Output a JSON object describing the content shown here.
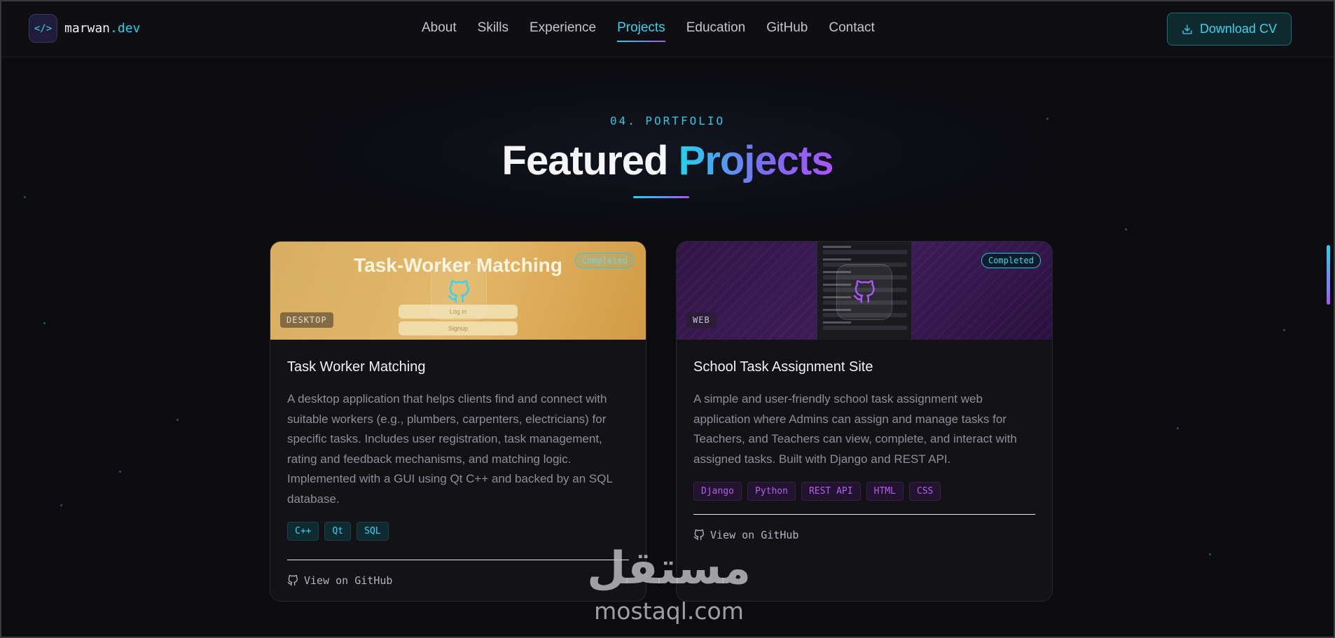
{
  "nav": {
    "brand_name": "marwan",
    "brand_tld": ".dev",
    "brand_icon": "</>",
    "links": [
      {
        "label": "About",
        "active": false
      },
      {
        "label": "Skills",
        "active": false
      },
      {
        "label": "Experience",
        "active": false
      },
      {
        "label": "Projects",
        "active": true
      },
      {
        "label": "Education",
        "active": false
      },
      {
        "label": "GitHub",
        "active": false
      },
      {
        "label": "Contact",
        "active": false
      }
    ],
    "cta_label": "Download CV",
    "cta_icon": "download-icon"
  },
  "section": {
    "eyebrow": "04. PORTFOLIO",
    "title_plain": "Featured ",
    "title_accent": "Projects"
  },
  "projects": [
    {
      "thumb_title": "Task-Worker Matching",
      "thumb_buttons": [
        "Log in",
        "Signup"
      ],
      "status": "Completed",
      "category": "DESKTOP",
      "title": "Task Worker Matching",
      "description": "A desktop application that helps clients find and connect with suitable workers (e.g., plumbers, carpenters, electricians) for specific tasks. Includes user registration, task management, rating and feedback mechanisms, and matching logic. Implemented with a GUI using Qt C++ and backed by an SQL database.",
      "tech": [
        "C++",
        "Qt",
        "SQL"
      ],
      "link_label": "View on GitHub"
    },
    {
      "status": "Completed",
      "category": "WEB",
      "title": "School Task Assignment Site",
      "description": "A simple and user-friendly school task assignment web application where Admins can assign and manage tasks for Teachers, and Teachers can view, complete, and interact with assigned tasks. Built with Django and REST API.",
      "tech": [
        "Django",
        "Python",
        "REST API",
        "HTML",
        "CSS"
      ],
      "link_label": "View on GitHub"
    }
  ],
  "watermark": {
    "arabic": "مستقل",
    "latin": "mostaql.com"
  },
  "colors": {
    "background": "#0b0b10",
    "accent_cyan": "#22d3ee",
    "accent_purple": "#a855f7"
  }
}
